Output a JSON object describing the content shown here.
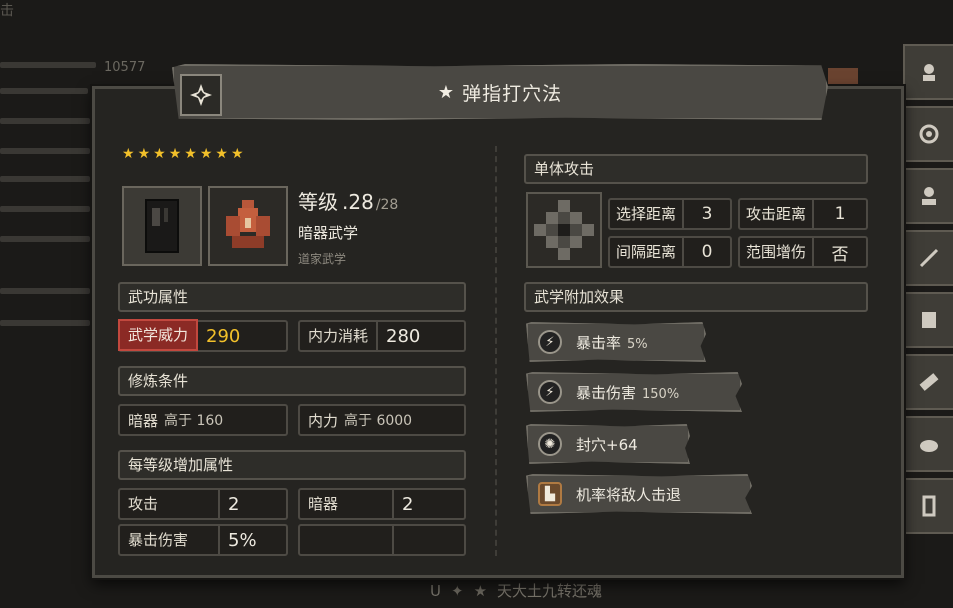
{
  "background": {
    "top_left_text": "击",
    "number_text": "10577",
    "bottom_text": "天大土九转还魂",
    "bottom_hotkey": "U"
  },
  "title": {
    "star": "★",
    "name": "弹指打穴法"
  },
  "stars_count": 8,
  "level": {
    "label": "等级",
    "value": ".28",
    "max": "/28"
  },
  "type_label": "暗器武学",
  "school_label": "道家武学",
  "sections": {
    "attributes": "武功属性",
    "requirements": "修炼条件",
    "per_level": "每等级增加属性",
    "attack_type": "单体攻击",
    "effects": "武学附加效果"
  },
  "attributes": [
    {
      "label": "武学威力",
      "value": "290"
    },
    {
      "label": "内力消耗",
      "value": "280"
    }
  ],
  "requirements": [
    {
      "label": "暗器",
      "value": "高于 160"
    },
    {
      "label": "内力",
      "value": "高于 6000"
    }
  ],
  "per_level": [
    {
      "label": "攻击",
      "value": "2"
    },
    {
      "label": "暗器",
      "value": "2"
    },
    {
      "label": "暴击伤害",
      "value": "5%"
    },
    {
      "label": "",
      "value": ""
    }
  ],
  "range_stats": [
    {
      "label": "选择距离",
      "value": "3"
    },
    {
      "label": "攻击距离",
      "value": "1"
    },
    {
      "label": "间隔距离",
      "value": "0"
    },
    {
      "label": "范围增伤",
      "value": "否"
    }
  ],
  "effects": [
    {
      "icon": "lightning-icon",
      "label": "暴击率",
      "value": "5%"
    },
    {
      "icon": "lightning-icon",
      "label": "暴击伤害",
      "value": "150%"
    },
    {
      "icon": "acupoint-icon",
      "label": "封穴+64",
      "value": ""
    },
    {
      "icon": "boot-icon",
      "label": "机率将敌人击退",
      "value": ""
    }
  ],
  "colors": {
    "gold": "#f2c02a",
    "power_red": "#8b2a25",
    "panel": "#252421"
  }
}
